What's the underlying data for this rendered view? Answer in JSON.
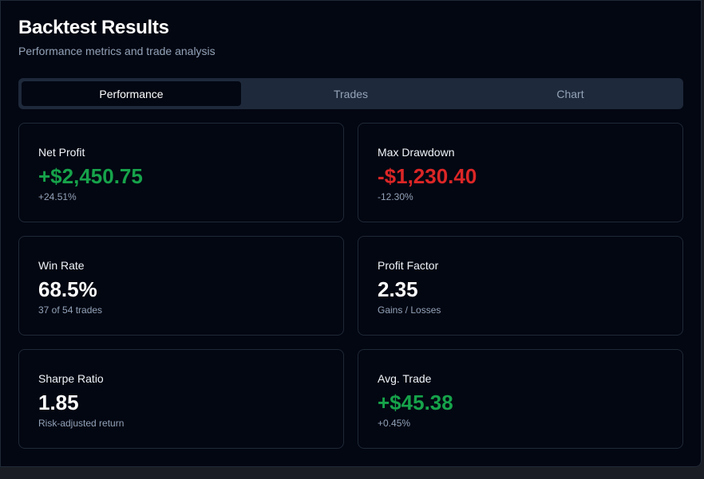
{
  "header": {
    "title": "Backtest Results",
    "subtitle": "Performance metrics and trade analysis"
  },
  "tabs": [
    {
      "label": "Performance",
      "active": true
    },
    {
      "label": "Trades",
      "active": false
    },
    {
      "label": "Chart",
      "active": false
    }
  ],
  "metrics": [
    {
      "label": "Net Profit",
      "value": "+$2,450.75",
      "sub": "+24.51%",
      "tone": "positive"
    },
    {
      "label": "Max Drawdown",
      "value": "-$1,230.40",
      "sub": "-12.30%",
      "tone": "negative"
    },
    {
      "label": "Win Rate",
      "value": "68.5%",
      "sub": "37 of 54 trades",
      "tone": "neutral"
    },
    {
      "label": "Profit Factor",
      "value": "2.35",
      "sub": "Gains / Losses",
      "tone": "neutral"
    },
    {
      "label": "Sharpe Ratio",
      "value": "1.85",
      "sub": "Risk-adjusted return",
      "tone": "neutral"
    },
    {
      "label": "Avg. Trade",
      "value": "+$45.38",
      "sub": "+0.45%",
      "tone": "positive"
    }
  ],
  "colors": {
    "background": "#030712",
    "positive": "#16a34a",
    "negative": "#dc2626",
    "muted": "#94a3b8",
    "tab_bar": "#1e293b"
  }
}
